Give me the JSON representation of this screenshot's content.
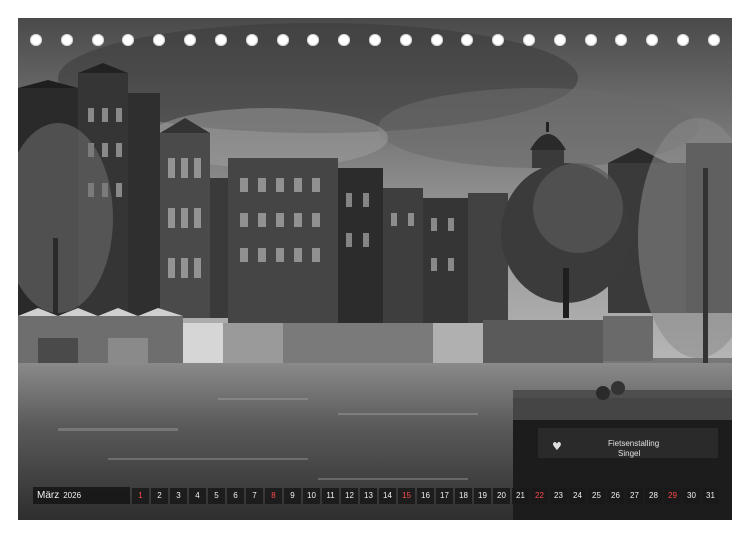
{
  "calendar": {
    "month": "März",
    "year": "2026",
    "days": [
      "1",
      "2",
      "3",
      "4",
      "5",
      "6",
      "7",
      "8",
      "9",
      "10",
      "11",
      "12",
      "13",
      "14",
      "15",
      "16",
      "17",
      "18",
      "19",
      "20",
      "21",
      "22",
      "23",
      "24",
      "25",
      "26",
      "27",
      "28",
      "29",
      "30",
      "31"
    ],
    "red_days": [
      "1",
      "8",
      "15",
      "22",
      "29"
    ]
  },
  "photo": {
    "sign_line1": "Fietsenstalling",
    "sign_line2": "Singel"
  },
  "colors": {
    "red_day": "#ff4a4a",
    "strip_bg": "#191919",
    "text": "#f0f0f0"
  }
}
